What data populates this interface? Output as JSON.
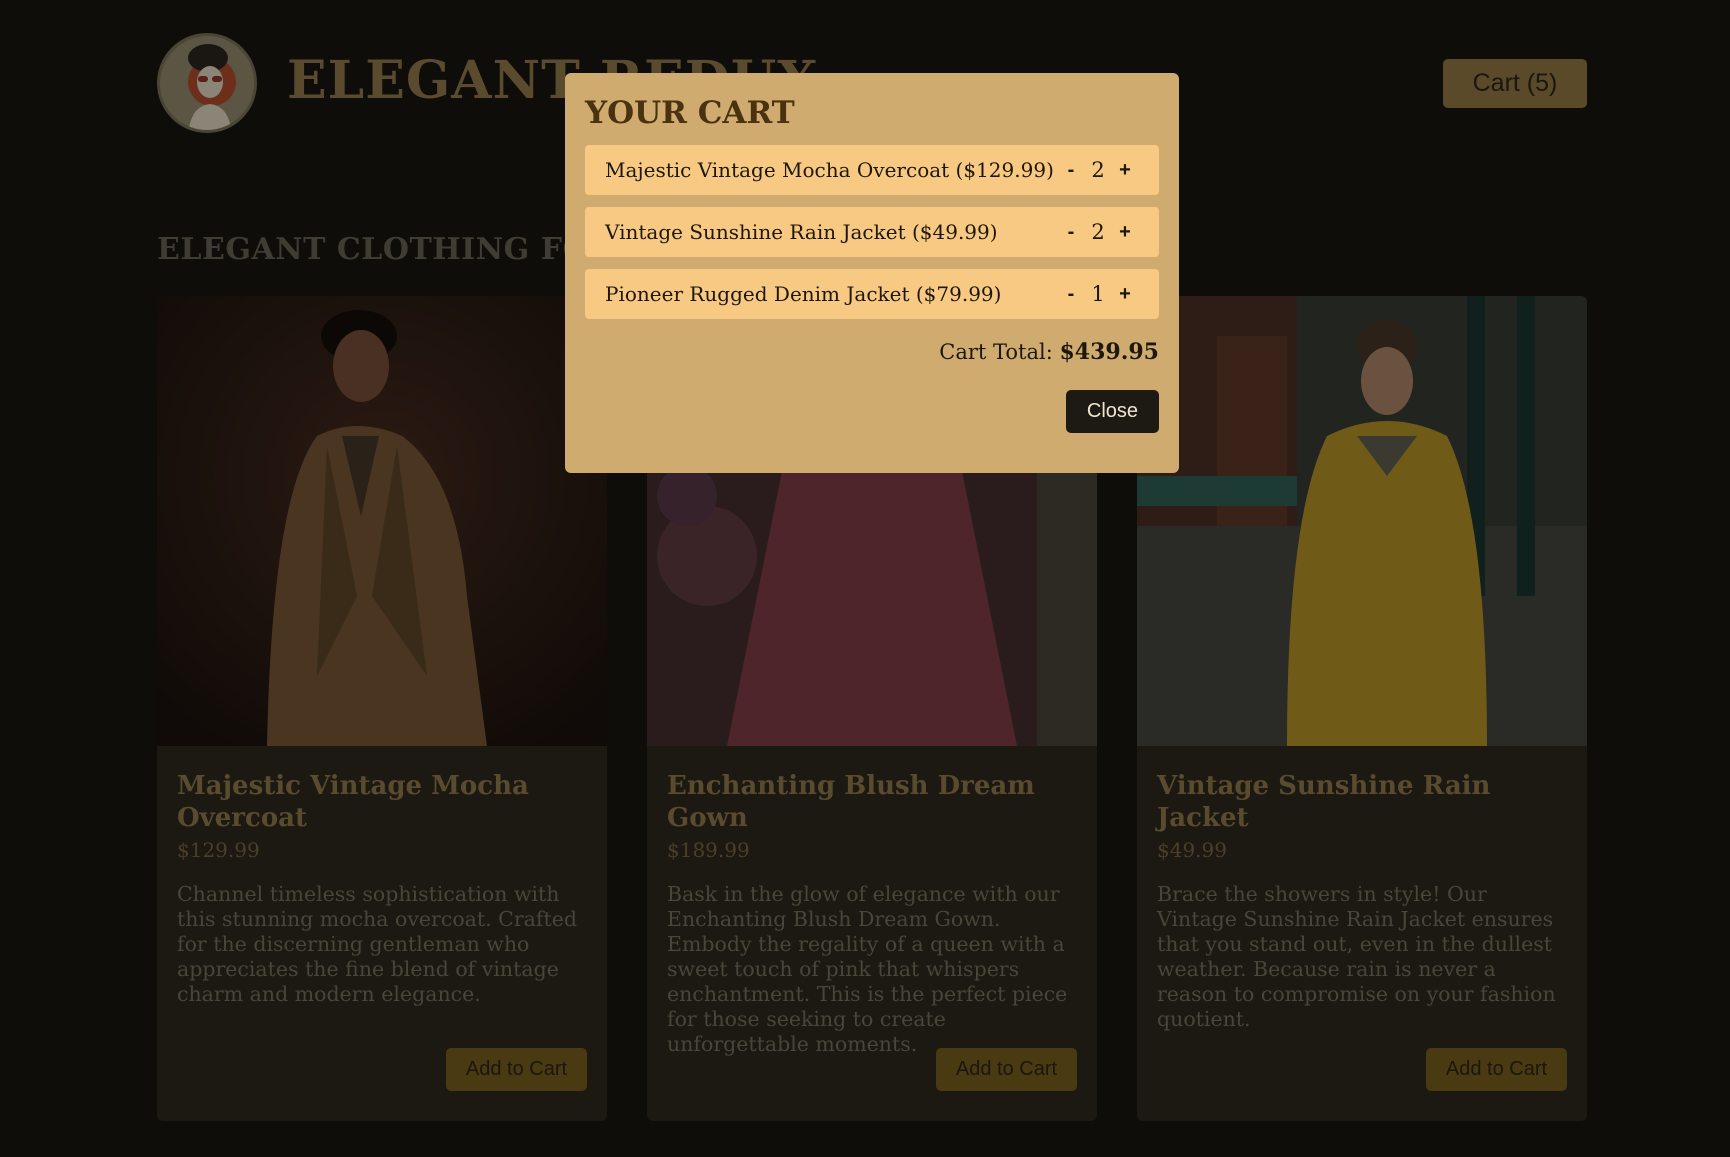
{
  "header": {
    "brand": "ELEGANT REDUX",
    "cart_button": "Cart (5)"
  },
  "section": {
    "title": "ELEGANT CLOTHING FOR E"
  },
  "products": [
    {
      "name": "Majestic Vintage Mocha Overcoat",
      "price": "$129.99",
      "description": "Channel timeless sophistication with this stunning mocha overcoat. Crafted for the discerning gentleman who appreciates the fine blend of vintage charm and modern elegance.",
      "button": "Add to Cart"
    },
    {
      "name": "Enchanting Blush Dream Gown",
      "price": "$189.99",
      "description": "Bask in the glow of elegance with our Enchanting Blush Dream Gown. Embody the regality of a queen with a sweet touch of pink that whispers enchantment. This is the perfect piece for those seeking to create unforgettable moments.",
      "button": "Add to Cart"
    },
    {
      "name": "Vintage Sunshine Rain Jacket",
      "price": "$49.99",
      "description": "Brace the showers in style! Our Vintage Sunshine Rain Jacket ensures that you stand out, even in the dullest weather. Because rain is never a reason to compromise on your fashion quotient.",
      "button": "Add to Cart"
    }
  ],
  "modal": {
    "title": "YOUR CART",
    "items": [
      {
        "label": "Majestic Vintage Mocha Overcoat ($129.99)",
        "minus": "-",
        "qty": "2",
        "plus": "+"
      },
      {
        "label": "Vintage Sunshine Rain Jacket ($49.99)",
        "minus": "-",
        "qty": "2",
        "plus": "+"
      },
      {
        "label": "Pioneer Rugged Denim Jacket ($79.99)",
        "minus": "-",
        "qty": "1",
        "plus": "+"
      }
    ],
    "total_label": "Cart Total:",
    "total_value": "$439.95",
    "close": "Close"
  },
  "colors": {
    "background": "#0f0d09",
    "modal": "#cfab6f",
    "cart_item": "#f8c982",
    "accent_button": "#4a3a12"
  }
}
